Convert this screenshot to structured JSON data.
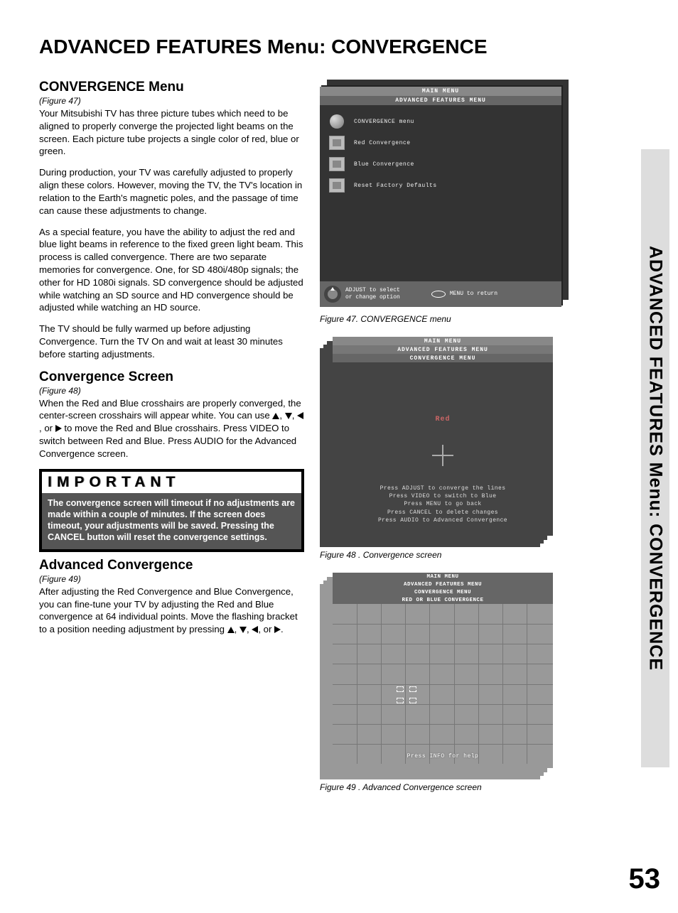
{
  "page_title": "ADVANCED FEATURES Menu: CONVERGENCE",
  "side_tab": "ADVANCED FEATURES Menu: CONVERGENCE",
  "page_number": "53",
  "sections": {
    "conv_menu": {
      "heading": "CONVERGENCE Menu",
      "figref": "(Figure 47)",
      "p1": "Your Mitsubishi TV has three picture tubes which need to be aligned to properly converge the projected light beams on the screen.  Each picture tube projects a single color of red, blue or green.",
      "p2": "During production, your TV was carefully adjusted to properly align these colors.  However, moving the TV, the TV's location in relation to the Earth's magnetic poles, and the passage of time can cause these adjustments to change.",
      "p3": "As a special feature, you have the ability to adjust the red and blue light beams in reference to the fixed green light beam. This process is called convergence. There are two separate memories for convergence. One, for SD 480i/480p signals; the other for HD 1080i signals.  SD convergence should be adjusted while watching an SD source and HD convergence should be adjusted while watching an HD source.",
      "p4": "The TV should be fully warmed up before adjusting Convergence.  Turn the TV On and wait at least 30 minutes before starting adjustments."
    },
    "conv_screen": {
      "heading": "Convergence Screen",
      "figref": "(Figure 48)",
      "p1a": "When the Red and Blue crosshairs are properly converged, the center-screen crosshairs will appear white.  You can use ",
      "p1b": " to move the Red and Blue crosshairs.  Press VIDEO to switch between Red and Blue.  Press AUDIO for the Advanced Convergence screen."
    },
    "important": {
      "header": "IMPORTANT",
      "body": "The convergence screen will timeout if no adjustments are made within a couple of minutes.  If the screen does timeout, your adjustments will be saved.  Pressing the CANCEL button will reset the convergence settings."
    },
    "adv_conv": {
      "heading": "Advanced Convergence",
      "figref": "(Figure 49)",
      "p1a": "After adjusting the Red Convergence and Blue Convergence, you can fine-tune your TV by adjusting the Red and Blue convergence at 64 individual points.  Move the flashing bracket to a position needing adjustment by pressing ",
      "p1b": "."
    }
  },
  "fig47": {
    "caption": "Figure 47.  CONVERGENCE menu",
    "hdr1": "MAIN MENU",
    "hdr2": "ADVANCED FEATURES MENU",
    "items": [
      "CONVERGENCE menu",
      "Red Convergence",
      "Blue Convergence",
      "Reset Factory Defaults"
    ],
    "footer_left": "ADJUST to select\nor change option",
    "footer_right": "MENU  to  return"
  },
  "fig48": {
    "caption": "Figure 48 .  Convergence screen",
    "hdr1": "MAIN MENU",
    "hdr2": "ADVANCED FEATURES MENU",
    "hdr3": "CONVERGENCE MENU",
    "red": "Red",
    "instr": "Press ADJUST to converge the lines\nPress VIDEO to switch to Blue\nPress MENU to go back\nPress CANCEL to delete changes\nPress AUDIO to Advanced Convergence"
  },
  "fig49": {
    "caption": "Figure  49 .  Advanced Convergence screen",
    "hdr1": "MAIN MENU",
    "hdr2": "ADVANCED FEATURES MENU",
    "hdr3": "CONVERGENCE MENU",
    "hdr4": "RED OR BLUE CONVERGENCE",
    "help": "Press INFO for help"
  }
}
